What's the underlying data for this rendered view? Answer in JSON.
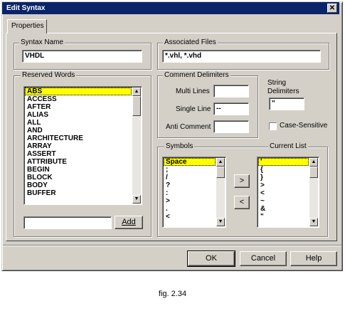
{
  "window": {
    "title": "Edit Syntax"
  },
  "tabs": [
    {
      "label": "Properties"
    }
  ],
  "syntax_name": {
    "label": "Syntax Name",
    "value": "VHDL"
  },
  "associated_files": {
    "label": "Associated Files",
    "value": "*.vhl, *.vhd"
  },
  "reserved_words": {
    "label": "Reserved Words",
    "items": [
      "ABS",
      "ACCESS",
      "AFTER",
      "ALIAS",
      "ALL",
      "AND",
      "ARCHITECTURE",
      "ARRAY",
      "ASSERT",
      "ATTRIBUTE",
      "BEGIN",
      "BLOCK",
      "BODY",
      "BUFFER"
    ],
    "input_value": "",
    "add_button": "Add"
  },
  "comment_delimiters": {
    "label": "Comment Delimiters",
    "multi_lines": {
      "label": "Multi Lines",
      "value": ""
    },
    "single_line": {
      "label": "Single Line",
      "value": "--"
    },
    "anti_comment": {
      "label": "Anti Comment",
      "value": ""
    }
  },
  "string_delimiters": {
    "label_line1": "String",
    "label_line2": "Delimiters",
    "value": "\""
  },
  "case_sensitive": {
    "label": "Case-Sensitive",
    "checked": false
  },
  "symbols": {
    "label": "Symbols",
    "items": [
      "Space",
      ";",
      "/",
      "?",
      ":",
      ">",
      ".",
      "<"
    ]
  },
  "move_right_button": ">",
  "move_left_button": "<",
  "current_list": {
    "label": "Current List",
    "items": [
      "'",
      "{",
      "}",
      ">",
      "<",
      "~",
      "&",
      "\""
    ]
  },
  "buttons": {
    "ok": "OK",
    "cancel": "Cancel",
    "help": "Help"
  },
  "caption": "fig. 2.34",
  "colors": {
    "titlebar": "#0a246a",
    "face": "#d4d0c8",
    "selection": "#ffff00"
  },
  "icons": {
    "close": "close-icon",
    "scroll_up": "scroll-up-icon",
    "scroll_down": "scroll-down-icon"
  }
}
